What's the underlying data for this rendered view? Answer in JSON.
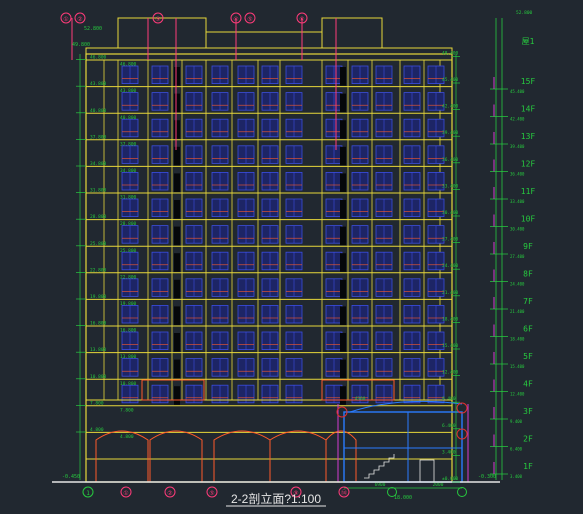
{
  "drawing": {
    "title": "2-2剖立面?1:100",
    "background": "#212830",
    "colors": {
      "structure": "#e8d83a",
      "dimension": "#27c93f",
      "leader": "#ff3b7a",
      "window": "#3b4ee0",
      "section": "#2a7bff",
      "accent": "#ff5a2a",
      "white": "#e6e6e6",
      "red": "#e03030"
    }
  },
  "floors_right": [
    "1F",
    "2F",
    "3F",
    "4F",
    "5F",
    "6F",
    "7F",
    "8F",
    "9F",
    "10F",
    "11F",
    "12F",
    "13F",
    "14F",
    "15F"
  ],
  "roof_label": "屋1",
  "axis_bubbles": {
    "bottom": [
      "1",
      "①",
      "②",
      "⑤",
      "⑨",
      "⑭"
    ],
    "top": [
      "①",
      "②",
      "③",
      "④",
      "⑤",
      "⑥"
    ]
  },
  "elevations_left": [
    "4.800",
    "7.800",
    "10.800",
    "13.800",
    "16.800",
    "19.800",
    "22.800",
    "25.800",
    "28.800",
    "31.800",
    "34.800",
    "37.800",
    "40.800",
    "43.800",
    "46.800"
  ],
  "elevations_right": [
    "±0.000",
    "3.400",
    "6.400",
    "9.400",
    "12.400",
    "15.400",
    "18.400",
    "21.400",
    "24.400",
    "27.400",
    "30.400",
    "33.400",
    "36.400",
    "39.400",
    "42.400",
    "45.400",
    "48.400"
  ],
  "misc_labels": {
    "left_ground": "-0.450",
    "right_ground": "-0.300",
    "roof_level": "49.800",
    "top_level": "52.800",
    "dim_total": "18.000",
    "dim_a": "6900",
    "dim_b": "2000",
    "dim_c": "4300"
  }
}
